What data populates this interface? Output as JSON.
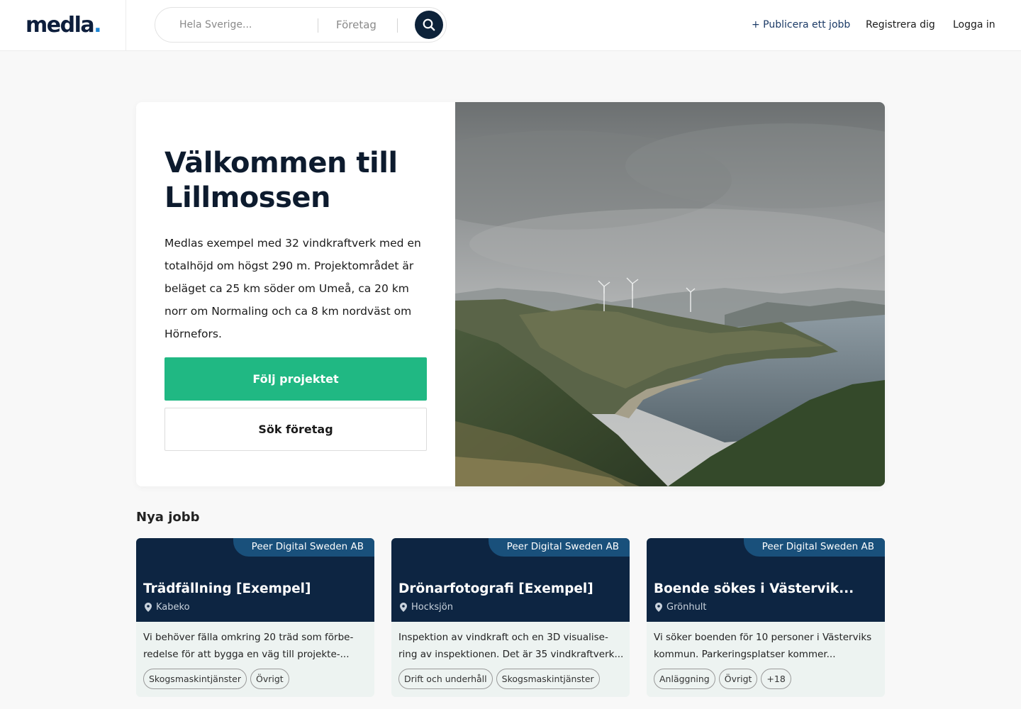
{
  "header": {
    "logo": "medla",
    "logo_dot": ".",
    "search_placeholder": "Hela Sverige...",
    "search_company": "Företag",
    "nav": {
      "publish": "+ Publicera ett jobb",
      "register": "Registrera dig",
      "login": "Logga in"
    }
  },
  "hero": {
    "title": "Välkommen till Lillmossen",
    "description": "Medlas exempel med 32 vindkraftverk med en totalhöjd om högst 290 m. Projektområdet är beläget ca 25 km söder om Umeå, ca 20 km norr om Normaling och ca 8 km nordväst om Hörnefors.",
    "follow_button": "Följ projektet",
    "search_button": "Sök företag"
  },
  "jobs": {
    "heading": "Nya jobb",
    "cards": [
      {
        "company": "Peer Digital Sweden AB",
        "title": "Trädfällning [Exempel]",
        "location": "Kabeko",
        "description": "Vi behöver fälla omkring 20 träd som förbe-redelse för att bygga en väg till projekte-...",
        "tags": [
          "Skogsmaskintjänster",
          "Övrigt"
        ]
      },
      {
        "company": "Peer Digital Sweden AB",
        "title": "Drönarfotografi [Exempel]",
        "location": "Hocksjön",
        "description": "Inspektion av vindkraft och en 3D visualise-ring av inspektionen. Det är 35 vindkraftverk...",
        "tags": [
          "Drift och underhåll",
          "Skogsmaskintjänster"
        ]
      },
      {
        "company": "Peer Digital Sweden AB",
        "title": "Boende sökes i Västervik...",
        "location": "Grönhult",
        "description": "Vi söker boenden för 10 personer i Västerviks kommun. Parkeringsplatser kommer...",
        "tags": [
          "Anläggning",
          "Övrigt",
          "+18"
        ]
      }
    ]
  }
}
